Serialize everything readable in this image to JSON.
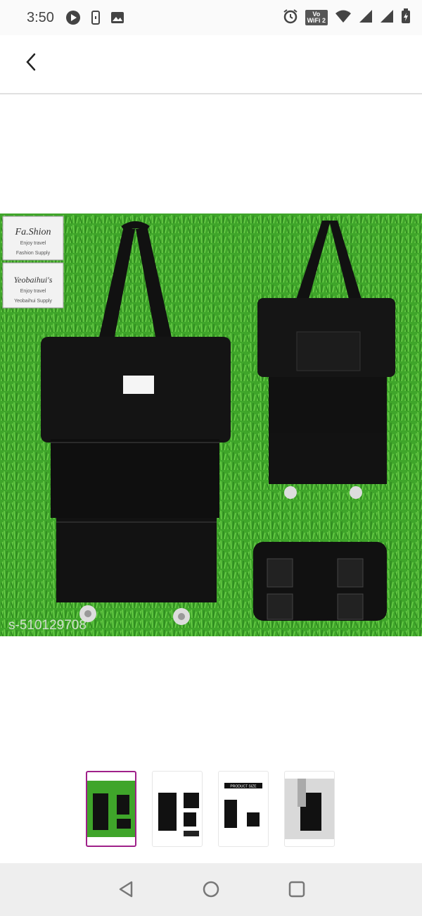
{
  "status_bar": {
    "time": "3:50",
    "icons": [
      "play-circle-icon",
      "phone-icon",
      "image-icon",
      "alarm-icon",
      "vowifi-icon",
      "wifi-icon",
      "signal-icon",
      "signal-icon-2",
      "battery-icon"
    ],
    "vowifi_line1": "Vo",
    "vowifi_line2": "WiFi 2"
  },
  "app_bar": {
    "back_icon": "chevron-left-icon"
  },
  "main_image": {
    "watermark": "s-510129708",
    "label_top": "Fa.Shion",
    "label_top_sub": "Enjoy travel",
    "label_top_foot": "Fashion Supply",
    "label_bottom": "Yeobaihui's",
    "label_bottom_sub": "Enjoy travel",
    "label_bottom_foot": "Yeobaihui Supply",
    "grass_color": "#3fa52a",
    "bag_color": "#111111"
  },
  "thumbnails": [
    {
      "name": "thumb-1",
      "selected": true
    },
    {
      "name": "thumb-2",
      "selected": false
    },
    {
      "name": "thumb-3",
      "selected": false,
      "caption": "PRODUCT SIZE"
    },
    {
      "name": "thumb-4",
      "selected": false
    }
  ],
  "colors": {
    "accent": "#9f2089",
    "navbar": "#eeeeee"
  }
}
